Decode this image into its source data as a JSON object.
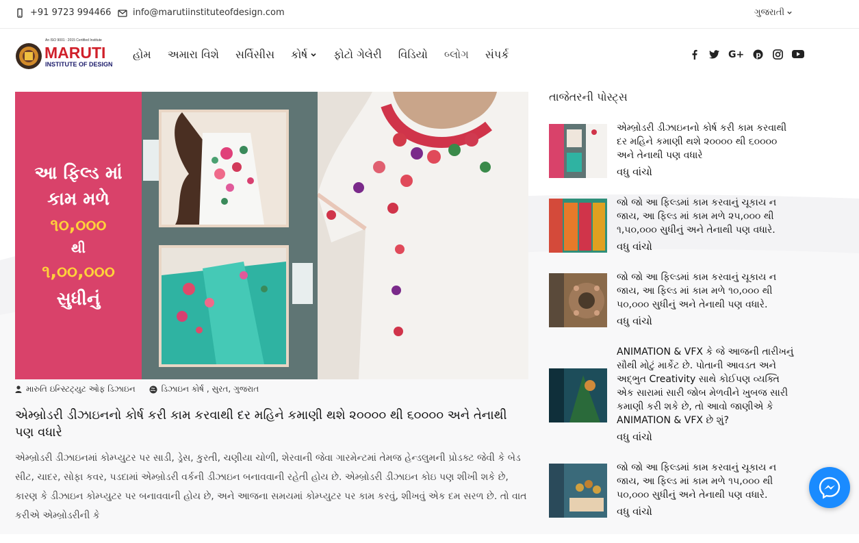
{
  "topbar": {
    "phone": "+91 9723 994466",
    "email": "info@marutiinstituteofdesign.com",
    "language": "ગુજરાતી"
  },
  "logo": {
    "name": "MARUTI",
    "subtitle": "INSTITUTE OF DESIGN",
    "tagline": "An ISO 9001 : 2015 Certified Institute"
  },
  "nav": {
    "items": [
      {
        "label": "હોમ"
      },
      {
        "label": "અમારા વિશે"
      },
      {
        "label": "સર્વિસીસ"
      },
      {
        "label": "કોર્ષ"
      },
      {
        "label": "ફોટો ગેલેરી"
      },
      {
        "label": "વિડિયો"
      },
      {
        "label": "બ્લોગ"
      },
      {
        "label": "સંપર્ક"
      }
    ]
  },
  "social": {
    "icons": [
      "facebook-icon",
      "twitter-icon",
      "google-plus-icon",
      "pinterest-icon",
      "instagram-icon",
      "youtube-icon"
    ]
  },
  "banner": {
    "line1": "આ ફિલ્ડ માં",
    "line2": "કામ મળે",
    "line3": "૧૦,૦૦૦",
    "line4": "થી",
    "line5": "૧,૦૦,૦૦૦",
    "line6": "સુધીનું"
  },
  "post": {
    "author": "મારુતિ ઇન્સ્ટિટ્યુટ ઓફ ડિઝાઇન",
    "categories": "ડિઝાઇન કોર્ષ , સુરત, ગુજરાત",
    "title": "એમ્બ્રોડરી ડીઝાઇનનો કોર્ષ કરી કામ કરવાથી દર મહિને કમાણી થશે ૨૦૦૦૦ થી ૬૦૦૦૦ અને તેનાથી પણ વધારે",
    "excerpt": "એમ્બ્રોડરી ડીઝાઇનમાં કોમ્પ્યુટર પર સાડી, ડ્રેસ, કુરતી, ચણીયા ચોળી, શેરવાની જેવા ગારમેન્ટમાં તેમજ હેન્ડલુમની પ્રોડક્ટ જેવી કે બેડ સીટ, ચાદર, સોફા કવર, પડદામાં એમ્બ્રોડરી વર્કની ડીઝાઇન બનાવવાની રહેતી હોય છે. એમ્બ્રોડરી ડીઝાઇન કોઇ પણ શીખી શકે છે, કારણ કે ડીઝાઇન કોમ્પ્યુટર પર બનાવવાની હોય છે, અને આજના સમયમાં કોમ્પ્યુટર પર કામ કરવું, શીખવું એક દમ સરળ છે. તો વાત કરીએ એમ્બ્રોડરીની કે"
  },
  "sidebar": {
    "heading": "તાજેતરની પોસ્ટ્સ",
    "read_more": "વધુ વાંચો",
    "posts": [
      {
        "title": "એમ્બ્રોડરી ડીઝાઇનનો કોર્ષ કરી કામ કરવાથી દર મહિને કમાણી થશે ૨૦૦૦૦ થી ૬૦૦૦૦ અને તેનાથી પણ વધારે",
        "thumb_color": "#d9426a"
      },
      {
        "title": "જો જો આ ફિલ્ડમાં કામ કરવાનું ચૂકાય ન જાય, આ ફિલ્ડ માં કામ મળે ૨૫,૦૦૦ થી ૧,૫૦,૦૦૦ સુધીનું અને તેનાથી પણ વધારે.",
        "thumb_color": "#2f8f7a"
      },
      {
        "title": "જો જો આ ફિલ્ડમાં કામ કરવાનું ચૂકાય ન જાય, આ ફિલ્ડ માં કામ મળે ૧૦,૦૦૦ થી ૫૦,૦૦૦ સુધીનું અને તેનાથી પણ વધારે.",
        "thumb_color": "#7a5a3a"
      },
      {
        "title": "ANIMATION & VFX કે જે આજની તારીખનું સૌથી મોટું માર્કેટ છે. પોતાની આવડત અને અદ્ભુત Creativity સાથે કોઈપણ વ્યક્તિ એક સારામાં સારી જોબ મેળવીને ખુબજ સારી કમાણી કરી શકે છે, તો આવો જાણીએ કે ANIMATION & VFX છે શું?",
        "thumb_color": "#1d4d5a"
      },
      {
        "title": "જો જો આ ફિલ્ડમાં કામ કરવાનું ચૂકાય ન જાય, આ ફિલ્ડ માં કામ મળે ૧૫,૦૦૦ થી ૫૦,૦૦૦ સુધીનું અને તેનાથી પણ વધારે.",
        "thumb_color": "#3a6a7a"
      }
    ]
  }
}
